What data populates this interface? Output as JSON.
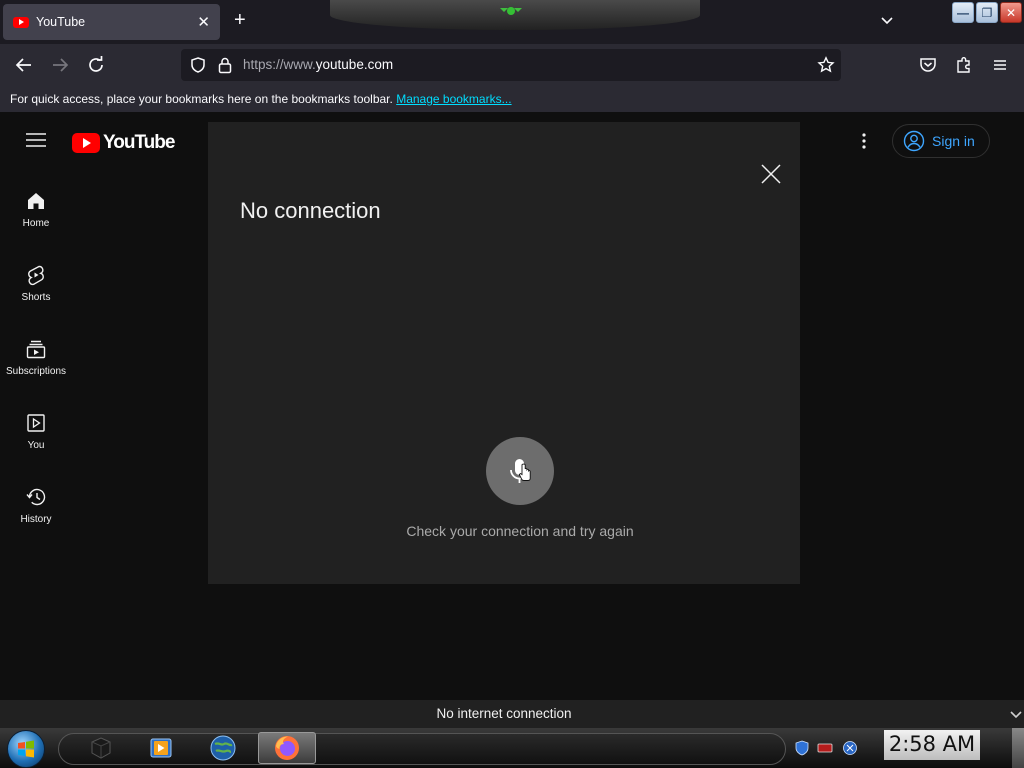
{
  "browser": {
    "tab": {
      "title": "YouTube",
      "close_glyph": "✕"
    },
    "new_tab_glyph": "+",
    "window_buttons": {
      "minimize": "—",
      "restore": "❐",
      "close": "✕"
    },
    "url": {
      "prefix": "https://www.",
      "domain": "youtube.com"
    },
    "bookmarks": {
      "text": "For quick access, place your bookmarks here on the bookmarks toolbar.",
      "link": "Manage bookmarks..."
    },
    "status": "No internet connection"
  },
  "youtube": {
    "logo_text": "YouTube",
    "sidebar": [
      {
        "label": "Home",
        "icon": "home-icon"
      },
      {
        "label": "Shorts",
        "icon": "shorts-icon"
      },
      {
        "label": "Subscriptions",
        "icon": "subscriptions-icon"
      },
      {
        "label": "You",
        "icon": "you-icon"
      },
      {
        "label": "History",
        "icon": "history-icon"
      }
    ],
    "sign_in": "Sign in"
  },
  "dialog": {
    "title": "No connection",
    "message": "Check your connection and try again"
  },
  "taskbar": {
    "clock": "2:58 AM"
  },
  "colors": {
    "youtube_red": "#ff0000",
    "link_blue": "#3ea6ff",
    "page_bg": "#0f0f0f",
    "dialog_bg": "#212121"
  }
}
